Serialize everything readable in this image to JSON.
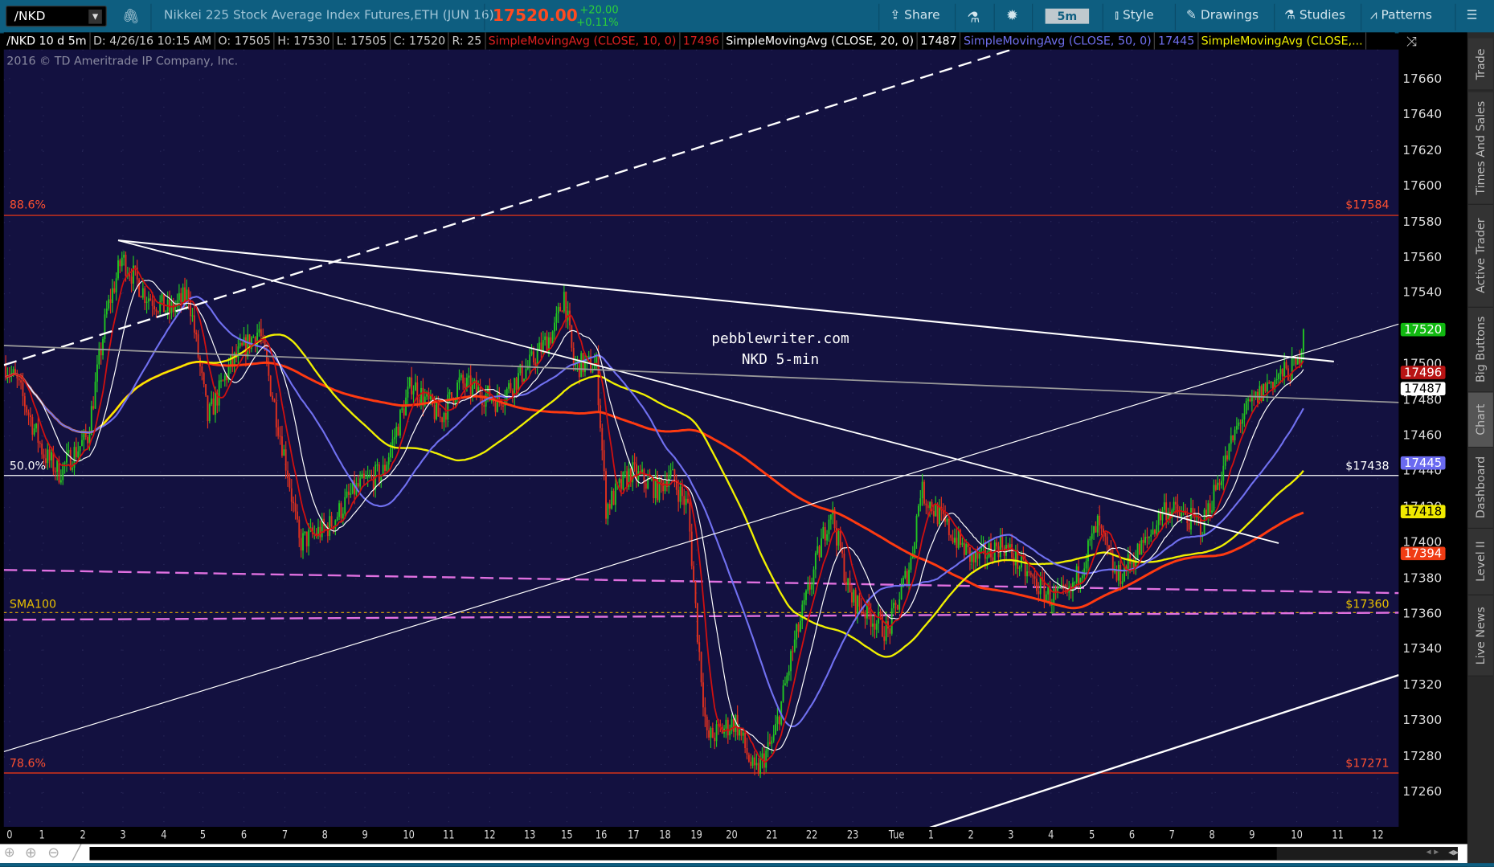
{
  "toolbar": {
    "symbol": "/NKD",
    "description": "Nikkei 225 Stock Average Index Futures,ETH (JUN 16)",
    "last": "17520.00",
    "change": "+20.00",
    "change_pct": "+0.11%",
    "share": "Share",
    "timeframe": "5m",
    "style": "Style",
    "drawings": "Drawings",
    "studies": "Studies",
    "patterns": "Patterns"
  },
  "infobar": {
    "symbol": "/NKD 10 d 5m",
    "date": "D: 4/26/16 10:15 AM",
    "open": "O: 17505",
    "high": "H: 17530",
    "low": "L: 17505",
    "close": "C: 17520",
    "range": "R: 25",
    "sma10": "SimpleMovingAvg (CLOSE, 10, 0)",
    "sma10_val": "17496",
    "sma20": "SimpleMovingAvg (CLOSE, 20, 0)",
    "sma20_val": "17487",
    "sma50": "SimpleMovingAvg (CLOSE, 50, 0)",
    "sma50_val": "17445",
    "sma_more": "SimpleMovingAvg (CLOSE,..."
  },
  "copyright": "2016 © TD Ameritrade IP Company, Inc.",
  "watermark": {
    "line1": "pebblewriter.com",
    "line2": "NKD 5-min"
  },
  "fib": {
    "l886": "88.6%",
    "v886": "$17584",
    "l50": "50.0%",
    "v50": "$17438",
    "l786": "78.6%",
    "v786": "$17271",
    "sma100": "SMA100",
    "v360": "$17360"
  },
  "price_axis": {
    "ticks": [
      "17660",
      "17640",
      "17620",
      "17600",
      "17580",
      "17560",
      "17540",
      "17520",
      "17500",
      "17480",
      "17460",
      "17440",
      "17420",
      "17400",
      "17380",
      "17360",
      "17340",
      "17320",
      "17300",
      "17280",
      "17260"
    ]
  },
  "price_tags": [
    {
      "v": "17520",
      "bg": "#11b811",
      "fg": "#fff"
    },
    {
      "v": "17496",
      "bg": "#b81414",
      "fg": "#fff"
    },
    {
      "v": "17487",
      "bg": "#ffffff",
      "fg": "#000"
    },
    {
      "v": "17445",
      "bg": "#6a6af0",
      "fg": "#fff"
    },
    {
      "v": "17418",
      "bg": "#f0ea00",
      "fg": "#000"
    },
    {
      "v": "17394",
      "bg": "#f03c14",
      "fg": "#fff"
    }
  ],
  "time_axis": [
    "0",
    "1",
    "2",
    "3",
    "4",
    "5",
    "6",
    "7",
    "8",
    "9",
    "10",
    "11",
    "12",
    "13",
    "15",
    "16",
    "17",
    "18",
    "19",
    "20",
    "21",
    "22",
    "23",
    "Tue",
    "1",
    "2",
    "3",
    "4",
    "5",
    "6",
    "7",
    "8",
    "9",
    "10",
    "11",
    "12"
  ],
  "side_tabs": [
    "Trade",
    "Times And Sales",
    "Active Trader",
    "Big Buttons",
    "Chart",
    "Dashboard",
    "Level II",
    "Live News"
  ],
  "colors": {
    "up": "#22c522",
    "down": "#e0301e",
    "sma10": "#d01010",
    "sma20": "#ffffff",
    "sma50": "#7070f0",
    "sma100": "#f0f000",
    "sma200": "#ff3a10",
    "bg": "#131140"
  },
  "chart_data": {
    "type": "candlestick",
    "price_range": [
      17250,
      17670
    ],
    "price_path": [
      [
        0,
        17500
      ],
      [
        12,
        17490
      ],
      [
        40,
        17450
      ],
      [
        56,
        17440
      ],
      [
        86,
        17460
      ],
      [
        106,
        17530
      ],
      [
        122,
        17560
      ],
      [
        146,
        17540
      ],
      [
        172,
        17530
      ],
      [
        192,
        17540
      ],
      [
        212,
        17470
      ],
      [
        236,
        17500
      ],
      [
        266,
        17520
      ],
      [
        296,
        17440
      ],
      [
        308,
        17400
      ],
      [
        340,
        17410
      ],
      [
        366,
        17430
      ],
      [
        396,
        17440
      ],
      [
        426,
        17490
      ],
      [
        456,
        17470
      ],
      [
        476,
        17490
      ],
      [
        516,
        17480
      ],
      [
        550,
        17500
      ],
      [
        576,
        17520
      ],
      [
        586,
        17540
      ],
      [
        596,
        17500
      ],
      [
        620,
        17500
      ],
      [
        630,
        17420
      ],
      [
        656,
        17440
      ],
      [
        686,
        17430
      ],
      [
        696,
        17440
      ],
      [
        716,
        17420
      ],
      [
        726,
        17350
      ],
      [
        736,
        17290
      ],
      [
        766,
        17300
      ],
      [
        786,
        17270
      ],
      [
        806,
        17290
      ],
      [
        826,
        17340
      ],
      [
        846,
        17380
      ],
      [
        866,
        17420
      ],
      [
        886,
        17370
      ],
      [
        906,
        17360
      ],
      [
        926,
        17350
      ],
      [
        950,
        17390
      ],
      [
        960,
        17430
      ],
      [
        986,
        17410
      ],
      [
        1016,
        17390
      ],
      [
        1046,
        17400
      ],
      [
        1076,
        17380
      ],
      [
        1096,
        17370
      ],
      [
        1116,
        17370
      ],
      [
        1146,
        17410
      ],
      [
        1166,
        17380
      ],
      [
        1196,
        17400
      ],
      [
        1216,
        17420
      ],
      [
        1256,
        17410
      ],
      [
        1276,
        17440
      ],
      [
        1296,
        17470
      ],
      [
        1326,
        17490
      ],
      [
        1356,
        17500
      ],
      [
        1362,
        17520
      ]
    ]
  }
}
